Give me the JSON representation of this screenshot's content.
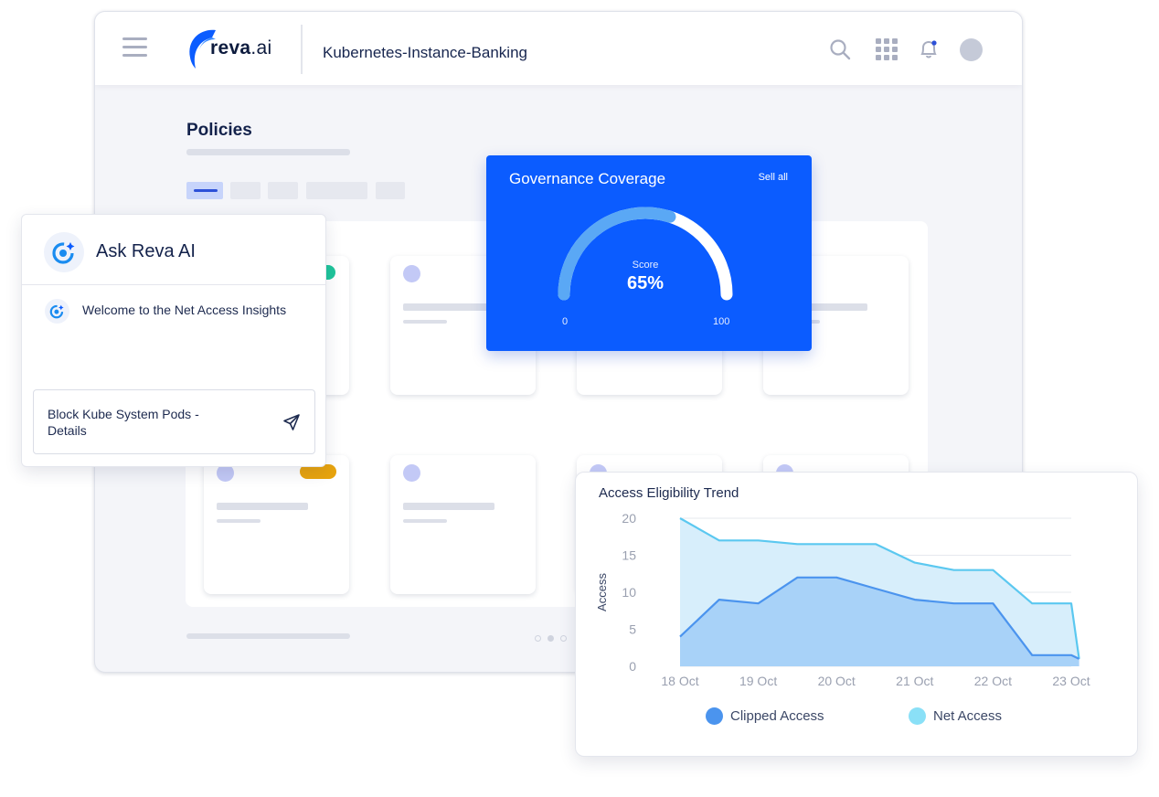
{
  "header": {
    "logo_text_bold": "reva",
    "logo_text_suffix": ".ai",
    "title": "Kubernetes-Instance-Banking",
    "icons": [
      "menu-icon",
      "search-icon",
      "apps-grid-icon",
      "bell-icon",
      "avatar"
    ]
  },
  "page": {
    "title": "Policies"
  },
  "governance": {
    "title": "Governance Coverage",
    "link": "Sell all",
    "score_label": "Score",
    "score_text": "65%",
    "score_value": 65,
    "min": "0",
    "max": "100",
    "colors": {
      "background": "#0b5cff",
      "track": "#ffffff",
      "progress": "#5aa8f5"
    }
  },
  "ask": {
    "title": "Ask Reva AI",
    "welcome": "Welcome to the Net Access Insights",
    "input_value": "Block Kube System Pods - Details"
  },
  "status_colors": {
    "green": "#1fc59b",
    "amber": "#e8a40e"
  },
  "chart_data": {
    "type": "area",
    "title": "Access Eligibility Trend",
    "ylabel": "Access",
    "xlabel": "",
    "ylim": [
      0,
      20
    ],
    "y_ticks": [
      0,
      5,
      10,
      15,
      20
    ],
    "x_tick_labels": [
      "18 Oct",
      "19 Oct",
      "20 Oct",
      "21 Oct",
      "22 Oct",
      "23 Oct"
    ],
    "x_ticks": [
      0,
      1,
      2,
      3,
      4,
      5
    ],
    "grid": true,
    "legend_position": "bottom",
    "series": [
      {
        "name": "Net Access",
        "color": "#5bc8f0",
        "fill": "#d7eefb",
        "x": [
          0,
          0.5,
          1,
          1.5,
          2,
          2.5,
          3,
          3.5,
          4,
          4.5,
          5,
          5.1
        ],
        "values": [
          20,
          17,
          17,
          16.5,
          16.5,
          16.5,
          14,
          13,
          13,
          8.5,
          8.5,
          1
        ]
      },
      {
        "name": "Clipped Access",
        "color": "#4b94ee",
        "fill": "#a8d2f8",
        "x": [
          0,
          0.5,
          1,
          1.5,
          2,
          2.5,
          3,
          3.5,
          4,
          4.5,
          5,
          5.1
        ],
        "values": [
          4,
          9,
          8.5,
          12,
          12,
          10.5,
          9,
          8.5,
          8.5,
          1.5,
          1.5,
          1
        ]
      }
    ],
    "legend": [
      "Clipped Access",
      "Net Access"
    ]
  }
}
